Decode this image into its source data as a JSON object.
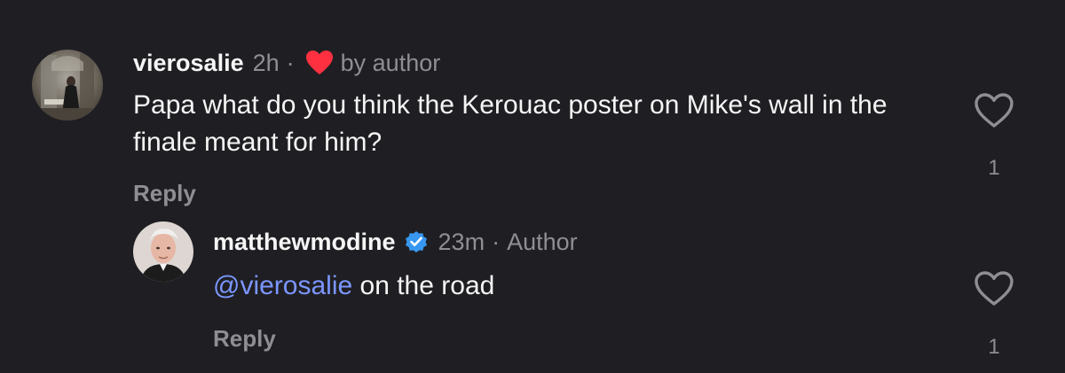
{
  "comments": [
    {
      "username": "vierosalie",
      "time": "2h",
      "separator": "·",
      "badge_text": "by author",
      "body": "Papa what do you think the Kerouac poster on Mike's wall in the finale meant for him?",
      "reply_label": "Reply",
      "like_count": "1",
      "avatar_icon": "user-avatar-photo",
      "badge_icon": "filled-heart-icon",
      "like_icon": "heart-outline-icon"
    },
    {
      "username": "matthewmodine",
      "verified_icon": "verified-badge-icon",
      "time": "23m",
      "separator": "·",
      "role": "Author",
      "mention": "@vierosalie",
      "body": " on the road",
      "reply_label": "Reply",
      "like_count": "1",
      "avatar_icon": "user-avatar-photo",
      "like_icon": "heart-outline-icon"
    }
  ],
  "colors": {
    "background": "#1f1f23",
    "text": "#f5f5f5",
    "muted": "#8e8e93",
    "mention": "#7b96ff",
    "like_heart": "#ff3040",
    "verified": "#3897f0"
  }
}
